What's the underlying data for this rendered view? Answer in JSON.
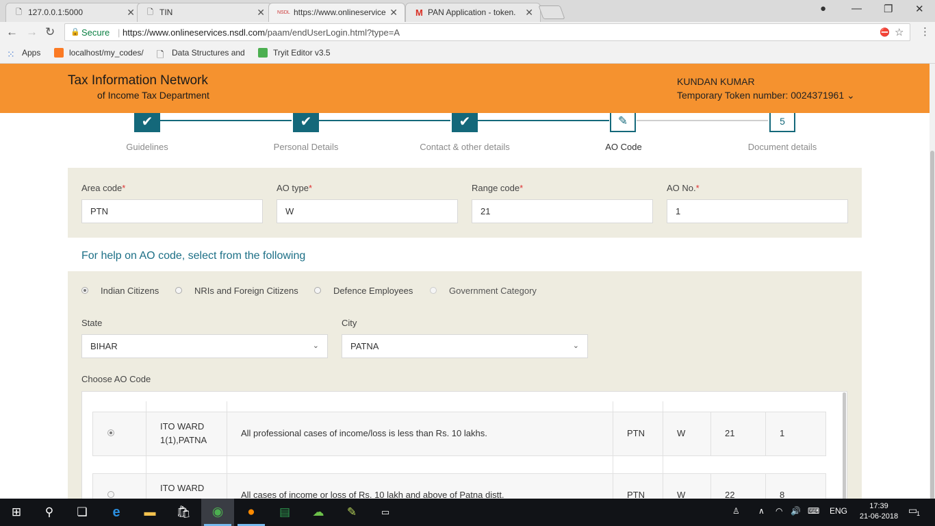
{
  "browser": {
    "tabs": [
      {
        "title": "127.0.0.1:5000",
        "favicon": "page-icon"
      },
      {
        "title": "TIN",
        "favicon": "page-icon"
      },
      {
        "title": "https://www.onlineservice",
        "favicon": "nsdl-icon"
      },
      {
        "title": "PAN Application - token.",
        "favicon": "gmail-icon"
      }
    ],
    "secure_label": "Secure",
    "url_host": "https://www.onlineservices.nsdl.com",
    "url_path": "/paam/endUserLogin.html?type=A",
    "bookmarks": [
      {
        "label": "Apps",
        "icon": "apps-grid-icon"
      },
      {
        "label": "localhost/my_codes/",
        "icon": "xampp-icon"
      },
      {
        "label": "Data Structures and",
        "icon": "page-icon"
      },
      {
        "label": "Tryit Editor v3.5",
        "icon": "w3schools-icon"
      }
    ]
  },
  "header": {
    "brand_line1": "Tax Information Network",
    "brand_line2": "of Income Tax Department",
    "user_name": "KUNDAN KUMAR",
    "token_label": "Temporary Token number: 0024371961 ⌄",
    "accent_color": "#f5922f"
  },
  "stepper": {
    "steps": [
      {
        "label": "Guidelines",
        "state": "done"
      },
      {
        "label": "Personal Details",
        "state": "done"
      },
      {
        "label": "Contact & other details",
        "state": "done"
      },
      {
        "label": "AO Code",
        "state": "current"
      },
      {
        "label": "Document details",
        "state": "pending",
        "number": "5"
      }
    ],
    "color": "#14687a"
  },
  "ao_form": {
    "area_code": {
      "label": "Area code",
      "value": "PTN"
    },
    "ao_type": {
      "label": "AO type",
      "value": "W"
    },
    "range_code": {
      "label": "Range code",
      "value": "21"
    },
    "ao_no": {
      "label": "AO No.",
      "value": "1"
    },
    "required_mark": "*"
  },
  "help_text": "For help on AO code, select from the following",
  "categories": [
    {
      "label": "Indian Citizens",
      "selected": true
    },
    {
      "label": "NRIs and Foreign Citizens",
      "selected": false
    },
    {
      "label": "Defence Employees",
      "selected": false
    },
    {
      "label": "Government Category",
      "selected": false,
      "disabled": true
    }
  ],
  "location": {
    "state_label": "State",
    "state_value": "BIHAR",
    "city_label": "City",
    "city_value": "PATNA"
  },
  "ao_table": {
    "title": "Choose AO Code",
    "rows": [
      {
        "selected": true,
        "ward_line1": "ITO WARD",
        "ward_line2": "1(1),PATNA",
        "description": "All professional cases of income/loss is less than Rs. 10 lakhs.",
        "area": "PTN",
        "type": "W",
        "range": "21",
        "no": "1"
      },
      {
        "selected": false,
        "ward_line1": "ITO WARD",
        "ward_line2": "",
        "description": "All cases of income or loss of Rs. 10 lakh and above of Patna distt.",
        "area": "PTN",
        "type": "W",
        "range": "22",
        "no": "8"
      }
    ]
  },
  "taskbar": {
    "language": "ENG",
    "time": "17:39",
    "date": "21-06-2018",
    "notifications": "1"
  }
}
